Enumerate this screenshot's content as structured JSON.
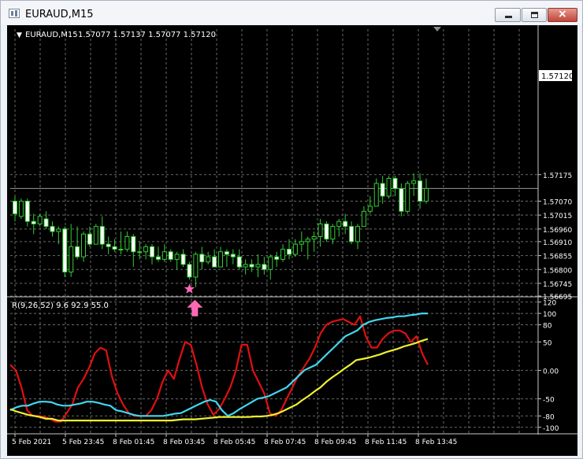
{
  "window": {
    "title": "EURAUD,M15",
    "buttons": {
      "minimize": "minimize",
      "maximize": "maximize",
      "close": "close"
    }
  },
  "chart_header": {
    "symbol": "EURAUD,M15",
    "ohlc": "1.57077 1.57137 1.57077 1.57120",
    "current_price": "1.57120"
  },
  "indicator_label": "R(9,26,52) 9.6 92.9 55.0",
  "colors": {
    "background": "#000000",
    "grid": "#6a6a6a",
    "candles": "#32cd32",
    "line_red": "#e01010",
    "line_cyan": "#40d8f0",
    "line_yellow": "#f0f030",
    "signal": "#ff69b4"
  },
  "chart_data": [
    {
      "type": "candlestick",
      "ylim": [
        1.56695,
        1.5775
      ],
      "y_ticks": [
        "1.57175",
        "1.57070",
        "1.57015",
        "1.56960",
        "1.56910",
        "1.56855",
        "1.56800",
        "1.56745",
        "1.56695"
      ],
      "x_labels": [
        "5 Feb 2021",
        "5 Feb 23:45",
        "8 Feb 01:45",
        "8 Feb 03:45",
        "8 Feb 05:45",
        "8 Feb 07:45",
        "8 Feb 09:45",
        "8 Feb 11:45",
        "8 Feb 13:45"
      ],
      "candles": [
        [
          1.5707,
          1.5709,
          1.5699,
          1.5702
        ],
        [
          1.5701,
          1.5708,
          1.57,
          1.5707
        ],
        [
          1.5707,
          1.5708,
          1.5697,
          1.5699
        ],
        [
          1.5699,
          1.5702,
          1.5694,
          1.5698
        ],
        [
          1.5698,
          1.5702,
          1.5697,
          1.5701
        ],
        [
          1.57,
          1.5703,
          1.5696,
          1.5697
        ],
        [
          1.5697,
          1.5699,
          1.5693,
          1.5695
        ],
        [
          1.5695,
          1.5697,
          1.569,
          1.5696
        ],
        [
          1.5696,
          1.5697,
          1.5677,
          1.5679
        ],
        [
          1.5679,
          1.5698,
          1.5677,
          1.5689
        ],
        [
          1.5689,
          1.5697,
          1.5684,
          1.5685
        ],
        [
          1.5685,
          1.5695,
          1.5683,
          1.5694
        ],
        [
          1.5694,
          1.5697,
          1.5689,
          1.569
        ],
        [
          1.569,
          1.5698,
          1.569,
          1.5697
        ],
        [
          1.5697,
          1.5701,
          1.5688,
          1.569
        ],
        [
          1.569,
          1.5693,
          1.5686,
          1.5689
        ],
        [
          1.5689,
          1.5692,
          1.5687,
          1.5688
        ],
        [
          1.5688,
          1.5695,
          1.5686,
          1.5688
        ],
        [
          1.5688,
          1.5695,
          1.5687,
          1.5693
        ],
        [
          1.5693,
          1.5694,
          1.5681,
          1.5687
        ],
        [
          1.5687,
          1.5691,
          1.5684,
          1.5687
        ],
        [
          1.5687,
          1.569,
          1.5684,
          1.5689
        ],
        [
          1.5689,
          1.569,
          1.5682,
          1.5685
        ],
        [
          1.5685,
          1.5689,
          1.5683,
          1.5684
        ],
        [
          1.5684,
          1.569,
          1.5683,
          1.5687
        ],
        [
          1.5687,
          1.5688,
          1.5683,
          1.5684
        ],
        [
          1.5684,
          1.5687,
          1.568,
          1.5686
        ],
        [
          1.5686,
          1.5688,
          1.5681,
          1.5682
        ],
        [
          1.5682,
          1.5683,
          1.5676,
          1.5677
        ],
        [
          1.5677,
          1.5687,
          1.5673,
          1.5686
        ],
        [
          1.5686,
          1.5689,
          1.568,
          1.5683
        ],
        [
          1.5683,
          1.5687,
          1.5682,
          1.5685
        ],
        [
          1.5685,
          1.5688,
          1.5681,
          1.5681
        ],
        [
          1.5681,
          1.5689,
          1.5681,
          1.5687
        ],
        [
          1.5687,
          1.5688,
          1.5681,
          1.5686
        ],
        [
          1.5686,
          1.5688,
          1.5682,
          1.5685
        ],
        [
          1.5685,
          1.5688,
          1.568,
          1.5681
        ],
        [
          1.5681,
          1.5684,
          1.5678,
          1.5682
        ],
        [
          1.5682,
          1.5684,
          1.5679,
          1.5681
        ],
        [
          1.5681,
          1.5686,
          1.5677,
          1.5682
        ],
        [
          1.5682,
          1.5685,
          1.5678,
          1.568
        ],
        [
          1.568,
          1.5686,
          1.5676,
          1.5685
        ],
        [
          1.5685,
          1.5687,
          1.5681,
          1.5684
        ],
        [
          1.5684,
          1.569,
          1.5683,
          1.5688
        ],
        [
          1.5688,
          1.5692,
          1.5684,
          1.5686
        ],
        [
          1.5686,
          1.5692,
          1.5685,
          1.569
        ],
        [
          1.569,
          1.5695,
          1.5687,
          1.5691
        ],
        [
          1.5691,
          1.5693,
          1.5684,
          1.5692
        ],
        [
          1.5692,
          1.5695,
          1.5687,
          1.5693
        ],
        [
          1.5693,
          1.57,
          1.5689,
          1.5698
        ],
        [
          1.5698,
          1.5699,
          1.5691,
          1.5692
        ],
        [
          1.5692,
          1.5698,
          1.569,
          1.5697
        ],
        [
          1.5697,
          1.57,
          1.5693,
          1.5699
        ],
        [
          1.5699,
          1.5702,
          1.5694,
          1.5697
        ],
        [
          1.5697,
          1.5699,
          1.569,
          1.5691
        ],
        [
          1.5691,
          1.5698,
          1.5688,
          1.5697
        ],
        [
          1.5697,
          1.5705,
          1.5697,
          1.5703
        ],
        [
          1.5703,
          1.5709,
          1.5702,
          1.5705
        ],
        [
          1.5705,
          1.5716,
          1.5705,
          1.5714
        ],
        [
          1.5714,
          1.5717,
          1.5706,
          1.5709
        ],
        [
          1.5709,
          1.5717,
          1.5708,
          1.5716
        ],
        [
          1.5716,
          1.5717,
          1.5709,
          1.5712
        ],
        [
          1.5712,
          1.5714,
          1.5701,
          1.5703
        ],
        [
          1.5703,
          1.5715,
          1.5702,
          1.5714
        ],
        [
          1.5714,
          1.5718,
          1.5709,
          1.5715
        ],
        [
          1.5715,
          1.5718,
          1.5704,
          1.5707
        ],
        [
          1.5707,
          1.5716,
          1.5706,
          1.5712
        ]
      ],
      "current_price": 1.5712,
      "signal": {
        "star_index": 28,
        "arrow_index": 29
      }
    },
    {
      "type": "line",
      "name": "R(9,26,52)",
      "ylim": [
        -110,
        125
      ],
      "y_ticks": [
        "120",
        "100",
        "80",
        "50",
        "0.00",
        "-50",
        "-80",
        "-100"
      ],
      "series": [
        {
          "color": "red",
          "values": [
            10,
            0,
            -30,
            -70,
            -80,
            -80,
            -82,
            -85,
            -90,
            -90,
            -75,
            -60,
            -30,
            -15,
            5,
            30,
            40,
            35,
            -10,
            -40,
            -60,
            -75,
            -80,
            -80,
            -80,
            -70,
            -50,
            -20,
            0,
            -15,
            20,
            50,
            45,
            10,
            -30,
            -60,
            -78,
            -68,
            -50,
            -30,
            0,
            45,
            45,
            0,
            -20,
            -40,
            -75,
            -80,
            -70,
            -50,
            -30,
            -10,
            5,
            20,
            40,
            65,
            80,
            85,
            88,
            90,
            85,
            80,
            95,
            60,
            40,
            40,
            55,
            65,
            70,
            70,
            65,
            50,
            60,
            30,
            10
          ]
        },
        {
          "color": "cyan",
          "values": [
            -70,
            -65,
            -62,
            -62,
            -58,
            -55,
            -55,
            -56,
            -60,
            -62,
            -62,
            -60,
            -58,
            -55,
            -55,
            -57,
            -60,
            -62,
            -70,
            -72,
            -75,
            -78,
            -80,
            -80,
            -80,
            -80,
            -80,
            -78,
            -76,
            -75,
            -70,
            -65,
            -60,
            -55,
            -52,
            -55,
            -70,
            -80,
            -75,
            -68,
            -62,
            -56,
            -50,
            -48,
            -45,
            -40,
            -35,
            -30,
            -20,
            -10,
            0,
            5,
            10,
            20,
            30,
            40,
            50,
            60,
            65,
            70,
            80,
            85,
            88,
            90,
            92,
            93,
            95,
            95,
            97,
            98,
            100,
            100
          ]
        },
        {
          "color": "yellow",
          "values": [
            -68,
            -72,
            -75,
            -78,
            -80,
            -82,
            -85,
            -85,
            -88,
            -88,
            -88,
            -88,
            -88,
            -88,
            -88,
            -88,
            -88,
            -88,
            -88,
            -88,
            -88,
            -88,
            -88,
            -88,
            -88,
            -88,
            -88,
            -88,
            -87,
            -86,
            -86,
            -86,
            -85,
            -84,
            -83,
            -82,
            -82,
            -82,
            -82,
            -82,
            -82,
            -81,
            -81,
            -80,
            -78,
            -75,
            -70,
            -65,
            -60,
            -52,
            -45,
            -37,
            -30,
            -20,
            -12,
            -5,
            3,
            10,
            18,
            20,
            22,
            25,
            28,
            32,
            35,
            38,
            42,
            45,
            48,
            52,
            55
          ]
        }
      ]
    }
  ]
}
